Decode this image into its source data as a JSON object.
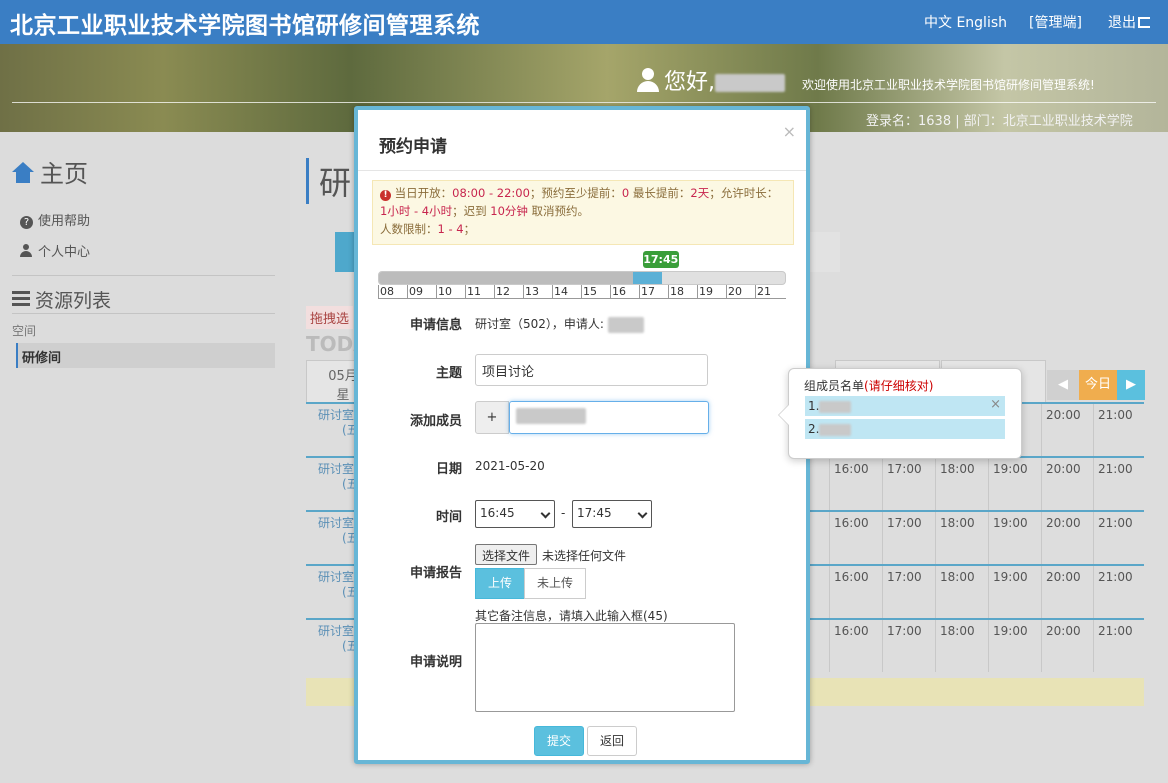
{
  "header": {
    "title": "北京工业职业技术学院图书馆研修间管理系统",
    "lang": "中文 English",
    "admin": "[管理端]",
    "logout": "退出"
  },
  "banner": {
    "hello": "您好,",
    "welcome": "欢迎使用北京工业职业技术学院图书馆研修间管理系统!",
    "login_info": "登录名：1638 | 部门：北京工业职业技术学院"
  },
  "sidebar": {
    "home": "主页",
    "help": "使用帮助",
    "personal": "个人中心",
    "resources": "资源列表",
    "category": "空间",
    "selected_item": "研修间"
  },
  "main": {
    "title": "研",
    "drag_hint": "拖拽选",
    "today": "TODA",
    "day_header": "05月",
    "day_sub": "星",
    "room_line1": "研讨室",
    "room_line2": "(五",
    "today_btn": "今日",
    "times": [
      "16:00",
      "17:00",
      "18:00",
      "19:00",
      "20:00",
      "21:00"
    ],
    "row0_times": [
      "20:00",
      "21:00"
    ]
  },
  "modal": {
    "title": "预约申请",
    "close": "×",
    "alert_line1_a": "当日开放：",
    "alert_open": "08:00 - 22:00",
    "alert_line1_b": "；预约至少提前：",
    "alert_min": "0",
    "alert_line1_c": " 最长提前：",
    "alert_max": "2天",
    "alert_line1_d": "；允许时长：",
    "alert_duration": "1小时 - 4小时",
    "alert_line2_a": "；迟到 ",
    "alert_late": "10分钟",
    "alert_line2_b": " 取消预约。",
    "alert_line3_a": "人数限制：",
    "alert_people": "1 - 4",
    "alert_line3_b": "；",
    "slider_tip": "17:45",
    "slider_selected_start_hours": 16.75,
    "slider_selected_end_hours": 17.75,
    "hours": [
      "08",
      "09",
      "10",
      "11",
      "12",
      "13",
      "14",
      "15",
      "16",
      "17",
      "18",
      "19",
      "20",
      "21"
    ],
    "label_info": "申请信息",
    "info_value": "研讨室（502），申请人:",
    "label_subject": "主题",
    "subject_value": "项目讨论",
    "label_members": "添加成员",
    "add_btn": "+",
    "label_date": "日期",
    "date_value": "2021-05-20",
    "label_time": "时间",
    "time_start": "16:45",
    "time_sep": "-",
    "time_end": "17:45",
    "label_report": "申请报告",
    "file_btn": "选择文件",
    "file_none": "未选择任何文件",
    "upload_yes": "上传",
    "upload_no": "未上传",
    "note_hint": "其它备注信息，请填入此输入框(45)",
    "label_desc": "申请说明",
    "submit": "提交",
    "back": "返回"
  },
  "popover": {
    "title": "组成员名单",
    "title_warn": "(请仔细核对)",
    "items": [
      "1.",
      "2."
    ],
    "remove": "×"
  },
  "colors": {
    "primary": "#3a7ec4",
    "info": "#5bc0de",
    "tip_green": "#3a9e3a",
    "alert_bg": "#fcf8e3",
    "alert_red": "#c7254e"
  }
}
